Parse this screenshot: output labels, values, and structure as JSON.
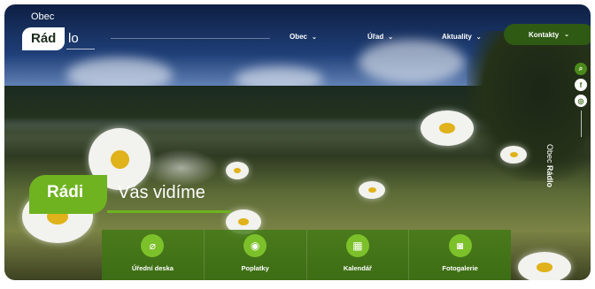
{
  "logo": {
    "top": "Obec",
    "part1": "Rád",
    "part2": "lo"
  },
  "nav": [
    {
      "label": "Obec",
      "icon": "chevron-down-icon"
    },
    {
      "label": "Úřad",
      "icon": "chevron-down-icon"
    },
    {
      "label": "Aktuality",
      "icon": "chevron-down-icon"
    }
  ],
  "contacts": {
    "label": "Kontakty",
    "icon": "chevron-down-icon"
  },
  "social": [
    "search-icon",
    "facebook-icon",
    "instagram-icon"
  ],
  "vertical": {
    "obec": "Obec",
    "name": "Rádlo"
  },
  "hero": {
    "highlight": "Rádi",
    "rest": "Vás vidíme"
  },
  "tiles": [
    {
      "label": "Úřední deska",
      "icon": "paperclip-icon"
    },
    {
      "label": "Poplatky",
      "icon": "coins-icon"
    },
    {
      "label": "Kalendář",
      "icon": "calendar-icon"
    },
    {
      "label": "Fotogalerie",
      "icon": "camera-icon"
    }
  ],
  "colors": {
    "accent": "#6fb320",
    "dark_green": "#2f5a14",
    "tile": "#3d7812"
  }
}
